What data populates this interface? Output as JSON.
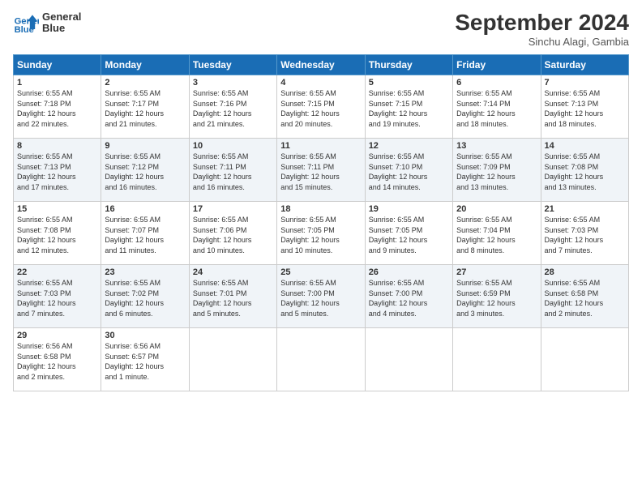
{
  "header": {
    "logo_line1": "General",
    "logo_line2": "Blue",
    "month_title": "September 2024",
    "location": "Sinchu Alagi, Gambia"
  },
  "weekdays": [
    "Sunday",
    "Monday",
    "Tuesday",
    "Wednesday",
    "Thursday",
    "Friday",
    "Saturday"
  ],
  "weeks": [
    [
      {
        "day": "1",
        "info": "Sunrise: 6:55 AM\nSunset: 7:18 PM\nDaylight: 12 hours\nand 22 minutes."
      },
      {
        "day": "2",
        "info": "Sunrise: 6:55 AM\nSunset: 7:17 PM\nDaylight: 12 hours\nand 21 minutes."
      },
      {
        "day": "3",
        "info": "Sunrise: 6:55 AM\nSunset: 7:16 PM\nDaylight: 12 hours\nand 21 minutes."
      },
      {
        "day": "4",
        "info": "Sunrise: 6:55 AM\nSunset: 7:15 PM\nDaylight: 12 hours\nand 20 minutes."
      },
      {
        "day": "5",
        "info": "Sunrise: 6:55 AM\nSunset: 7:15 PM\nDaylight: 12 hours\nand 19 minutes."
      },
      {
        "day": "6",
        "info": "Sunrise: 6:55 AM\nSunset: 7:14 PM\nDaylight: 12 hours\nand 18 minutes."
      },
      {
        "day": "7",
        "info": "Sunrise: 6:55 AM\nSunset: 7:13 PM\nDaylight: 12 hours\nand 18 minutes."
      }
    ],
    [
      {
        "day": "8",
        "info": "Sunrise: 6:55 AM\nSunset: 7:13 PM\nDaylight: 12 hours\nand 17 minutes."
      },
      {
        "day": "9",
        "info": "Sunrise: 6:55 AM\nSunset: 7:12 PM\nDaylight: 12 hours\nand 16 minutes."
      },
      {
        "day": "10",
        "info": "Sunrise: 6:55 AM\nSunset: 7:11 PM\nDaylight: 12 hours\nand 16 minutes."
      },
      {
        "day": "11",
        "info": "Sunrise: 6:55 AM\nSunset: 7:11 PM\nDaylight: 12 hours\nand 15 minutes."
      },
      {
        "day": "12",
        "info": "Sunrise: 6:55 AM\nSunset: 7:10 PM\nDaylight: 12 hours\nand 14 minutes."
      },
      {
        "day": "13",
        "info": "Sunrise: 6:55 AM\nSunset: 7:09 PM\nDaylight: 12 hours\nand 13 minutes."
      },
      {
        "day": "14",
        "info": "Sunrise: 6:55 AM\nSunset: 7:08 PM\nDaylight: 12 hours\nand 13 minutes."
      }
    ],
    [
      {
        "day": "15",
        "info": "Sunrise: 6:55 AM\nSunset: 7:08 PM\nDaylight: 12 hours\nand 12 minutes."
      },
      {
        "day": "16",
        "info": "Sunrise: 6:55 AM\nSunset: 7:07 PM\nDaylight: 12 hours\nand 11 minutes."
      },
      {
        "day": "17",
        "info": "Sunrise: 6:55 AM\nSunset: 7:06 PM\nDaylight: 12 hours\nand 10 minutes."
      },
      {
        "day": "18",
        "info": "Sunrise: 6:55 AM\nSunset: 7:05 PM\nDaylight: 12 hours\nand 10 minutes."
      },
      {
        "day": "19",
        "info": "Sunrise: 6:55 AM\nSunset: 7:05 PM\nDaylight: 12 hours\nand 9 minutes."
      },
      {
        "day": "20",
        "info": "Sunrise: 6:55 AM\nSunset: 7:04 PM\nDaylight: 12 hours\nand 8 minutes."
      },
      {
        "day": "21",
        "info": "Sunrise: 6:55 AM\nSunset: 7:03 PM\nDaylight: 12 hours\nand 7 minutes."
      }
    ],
    [
      {
        "day": "22",
        "info": "Sunrise: 6:55 AM\nSunset: 7:03 PM\nDaylight: 12 hours\nand 7 minutes."
      },
      {
        "day": "23",
        "info": "Sunrise: 6:55 AM\nSunset: 7:02 PM\nDaylight: 12 hours\nand 6 minutes."
      },
      {
        "day": "24",
        "info": "Sunrise: 6:55 AM\nSunset: 7:01 PM\nDaylight: 12 hours\nand 5 minutes."
      },
      {
        "day": "25",
        "info": "Sunrise: 6:55 AM\nSunset: 7:00 PM\nDaylight: 12 hours\nand 5 minutes."
      },
      {
        "day": "26",
        "info": "Sunrise: 6:55 AM\nSunset: 7:00 PM\nDaylight: 12 hours\nand 4 minutes."
      },
      {
        "day": "27",
        "info": "Sunrise: 6:55 AM\nSunset: 6:59 PM\nDaylight: 12 hours\nand 3 minutes."
      },
      {
        "day": "28",
        "info": "Sunrise: 6:55 AM\nSunset: 6:58 PM\nDaylight: 12 hours\nand 2 minutes."
      }
    ],
    [
      {
        "day": "29",
        "info": "Sunrise: 6:56 AM\nSunset: 6:58 PM\nDaylight: 12 hours\nand 2 minutes."
      },
      {
        "day": "30",
        "info": "Sunrise: 6:56 AM\nSunset: 6:57 PM\nDaylight: 12 hours\nand 1 minute."
      },
      {
        "day": "",
        "info": ""
      },
      {
        "day": "",
        "info": ""
      },
      {
        "day": "",
        "info": ""
      },
      {
        "day": "",
        "info": ""
      },
      {
        "day": "",
        "info": ""
      }
    ]
  ]
}
